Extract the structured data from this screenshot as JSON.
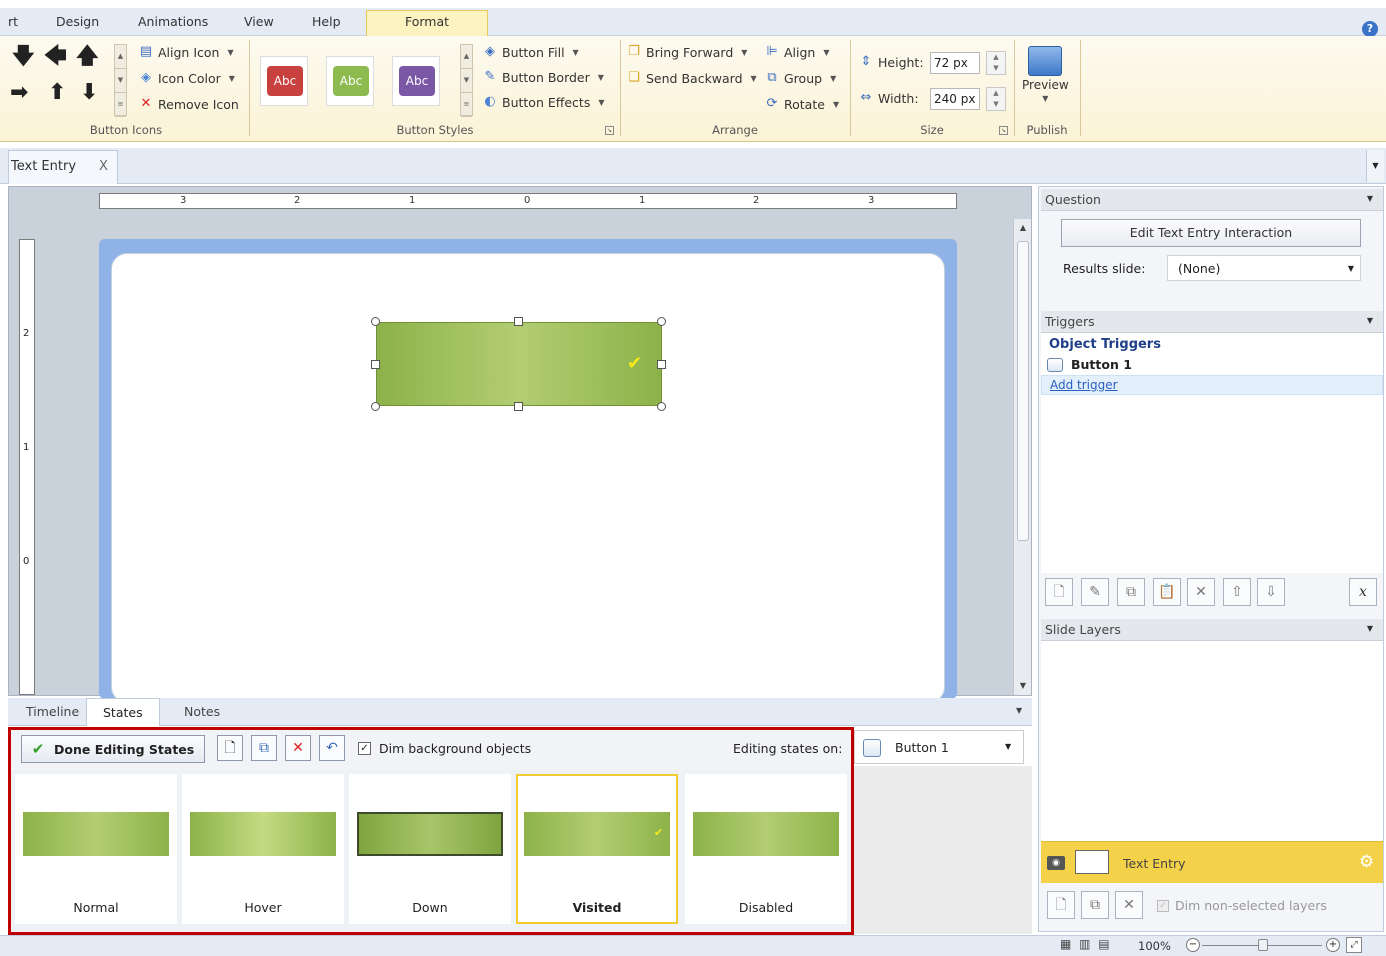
{
  "ribbon_tabs": [
    "rt",
    "Design",
    "Animations",
    "View",
    "Help",
    "Format"
  ],
  "active_tab": "Format",
  "help_badge": "?",
  "groups": {
    "button_icons": {
      "label": "Button Icons",
      "align_icon": "Align Icon",
      "icon_color": "Icon Color",
      "remove_icon": "Remove Icon"
    },
    "button_styles": {
      "label": "Button Styles",
      "swatches": [
        {
          "text": "Abc",
          "color": "#c9413e"
        },
        {
          "text": "Abc",
          "color": "#8dbb4f"
        },
        {
          "text": "Abc",
          "color": "#7a58a6"
        }
      ],
      "button_fill": "Button Fill",
      "button_border": "Button Border",
      "button_effects": "Button Effects"
    },
    "arrange": {
      "label": "Arrange",
      "bring_forward": "Bring Forward",
      "send_backward": "Send Backward",
      "align": "Align",
      "group": "Group",
      "rotate": "Rotate"
    },
    "size": {
      "label": "Size",
      "height_label": "Height:",
      "height_value": "72 px",
      "width_label": "Width:",
      "width_value": "240 px"
    },
    "publish": {
      "label": "Publish",
      "preview": "Preview"
    }
  },
  "document_tab": {
    "title": "Text Entry",
    "close": "X"
  },
  "ruler": {
    "h_numbers": [
      "3",
      "2",
      "1",
      "0",
      "1",
      "2",
      "3"
    ],
    "v_numbers": [
      "2",
      "1",
      "0"
    ]
  },
  "bottom_tabs": [
    "Timeline",
    "States",
    "Notes"
  ],
  "active_bottom_tab": "States",
  "states_panel": {
    "done_button": "Done Editing States",
    "dim_background_label": "Dim background objects",
    "dim_background_checked": true,
    "editing_states_label": "Editing states on:",
    "editing_object": "Button 1",
    "states": [
      {
        "name": "Normal",
        "selected": false
      },
      {
        "name": "Hover",
        "selected": false
      },
      {
        "name": "Down",
        "selected": false
      },
      {
        "name": "Visited",
        "selected": true
      },
      {
        "name": "Disabled",
        "selected": false
      }
    ]
  },
  "question_panel": {
    "title": "Question",
    "edit_button": "Edit Text Entry Interaction",
    "results_label": "Results slide:",
    "results_value": "(None)"
  },
  "triggers_panel": {
    "title": "Triggers",
    "section": "Object Triggers",
    "object": "Button 1",
    "add_trigger": "Add trigger",
    "delete_label": "x"
  },
  "slide_layers_panel": {
    "title": "Slide Layers",
    "layer_name": "Text Entry",
    "dim_non_selected": "Dim non-selected layers"
  },
  "status_bar": {
    "zoom": "100%"
  },
  "colors": {
    "accent_red": "#c00000",
    "layer_highlight": "#f3d24a",
    "button_green": "#8db24a"
  }
}
